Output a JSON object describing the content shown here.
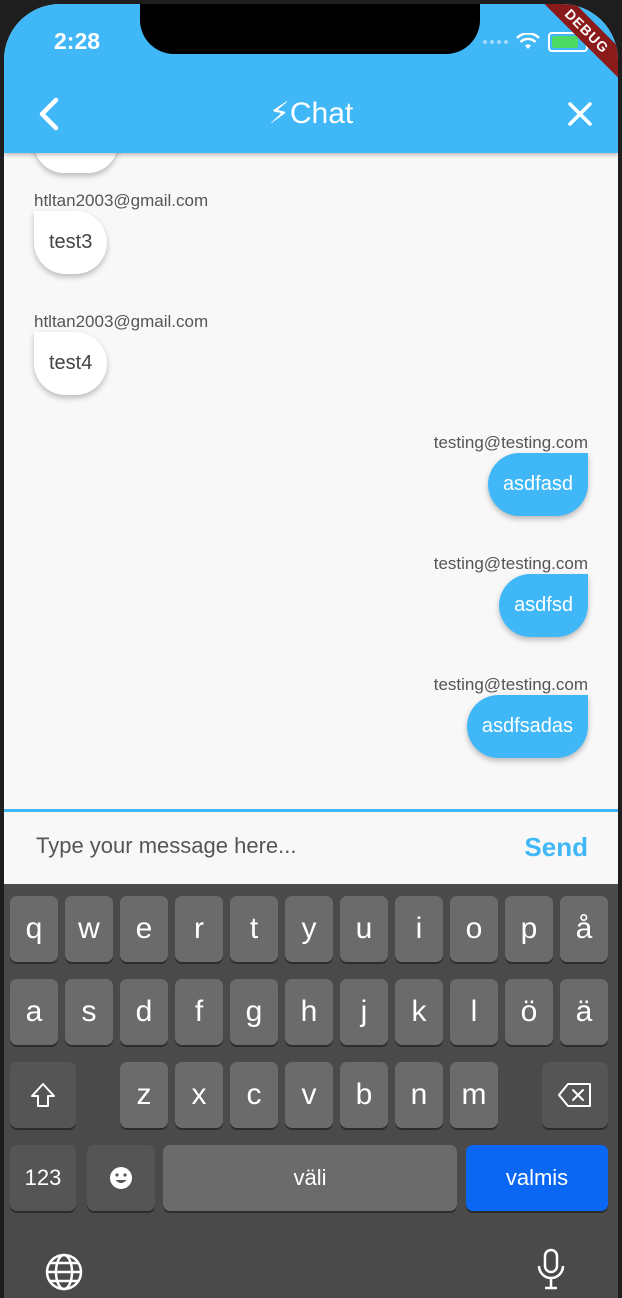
{
  "status": {
    "time": "2:28",
    "debug_label": "DEBUG"
  },
  "appbar": {
    "title": "⚡Chat"
  },
  "messages": [
    {
      "sender": "htltan2003@gmail.com",
      "text": "test3",
      "side": "left"
    },
    {
      "sender": "htltan2003@gmail.com",
      "text": "test4",
      "side": "left"
    },
    {
      "sender": "testing@testing.com",
      "text": "asdfasd",
      "side": "right"
    },
    {
      "sender": "testing@testing.com",
      "text": "asdfsd",
      "side": "right"
    },
    {
      "sender": "testing@testing.com",
      "text": "asdfsadas",
      "side": "right"
    }
  ],
  "composer": {
    "placeholder": "Type your message here...",
    "send_label": "Send"
  },
  "keyboard": {
    "row1": [
      "q",
      "w",
      "e",
      "r",
      "t",
      "y",
      "u",
      "i",
      "o",
      "p",
      "å"
    ],
    "row2": [
      "a",
      "s",
      "d",
      "f",
      "g",
      "h",
      "j",
      "k",
      "l",
      "ö",
      "ä"
    ],
    "row3": [
      "z",
      "x",
      "c",
      "v",
      "b",
      "n",
      "m"
    ],
    "numbers_label": "123",
    "space_label": "väli",
    "return_label": "valmis"
  },
  "colors": {
    "accent": "#40b7f7",
    "return_key": "#0a67f3"
  }
}
